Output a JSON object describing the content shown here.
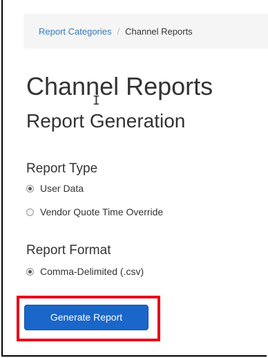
{
  "breadcrumb": {
    "items": [
      {
        "label": "Report Categories",
        "link": true
      },
      {
        "label": "Channel Reports",
        "link": false
      }
    ],
    "separator": "/"
  },
  "page": {
    "title": "Channel Reports",
    "subtitle": "Report Generation"
  },
  "report_type": {
    "label": "Report Type",
    "options": [
      {
        "label": "User Data",
        "checked": true
      },
      {
        "label": "Vendor Quote Time Override",
        "checked": false
      }
    ]
  },
  "report_format": {
    "label": "Report Format",
    "options": [
      {
        "label": "Comma-Delimited (.csv)",
        "checked": true
      }
    ]
  },
  "actions": {
    "generate_label": "Generate Report"
  },
  "colors": {
    "link": "#337ab7",
    "button": "#1a66c9",
    "highlight": "#e8001c"
  }
}
